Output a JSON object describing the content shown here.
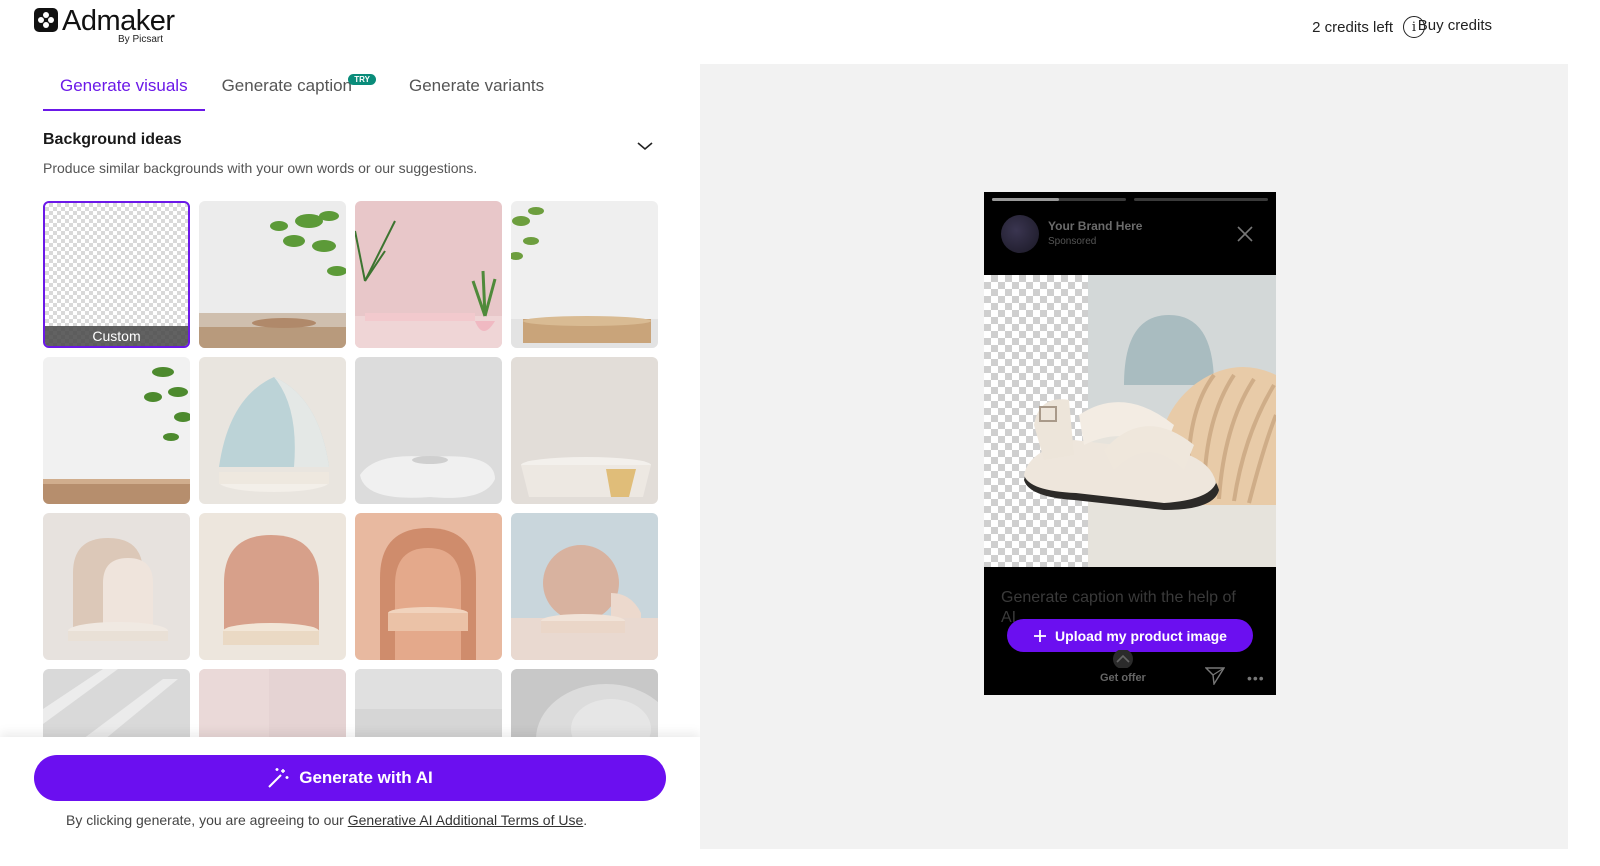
{
  "header": {
    "logo_text": "Admaker",
    "logo_sub": "By Picsart",
    "credits_text": "2 credits left",
    "info_icon": "info-icon",
    "buy_credits": "Buy credits"
  },
  "tabs": [
    {
      "label": "Generate visuals",
      "active": true
    },
    {
      "label": "Generate caption",
      "badge": "TRY"
    },
    {
      "label": "Generate variants"
    }
  ],
  "background_ideas": {
    "title": "Background ideas",
    "description": "Produce similar backgrounds with your own words or our suggestions.",
    "custom_label": "Custom",
    "tiles": [
      "custom",
      "wood-plants",
      "pink-wall-plant",
      "log-slice",
      "wood-leaves",
      "blue-vase",
      "white-stone",
      "marble-podium",
      "beige-arch",
      "terracotta-arch",
      "peach-niche",
      "blue-circle",
      "marble-texture",
      "pink-plain",
      "grey-plain",
      "stone-rock"
    ]
  },
  "actions": {
    "generate_label": "Generate with AI",
    "terms_prefix": "By clicking generate, you are agreeing to our ",
    "terms_link": "Generative AI Additional Terms of Use",
    "terms_suffix": "."
  },
  "preview": {
    "brand": "Your Brand Here",
    "sponsored": "Sponsored",
    "caption_placeholder": "Generate caption with the help of AI",
    "upload_label": "Upload my product image",
    "get_offer": "Get offer",
    "progress": [
      0.5,
      0
    ]
  },
  "colors": {
    "accent": "#6b0ff0",
    "tab_active": "#6b18e8",
    "badge": "#0a8c7a",
    "preview_bg": "#f2f2f2"
  }
}
